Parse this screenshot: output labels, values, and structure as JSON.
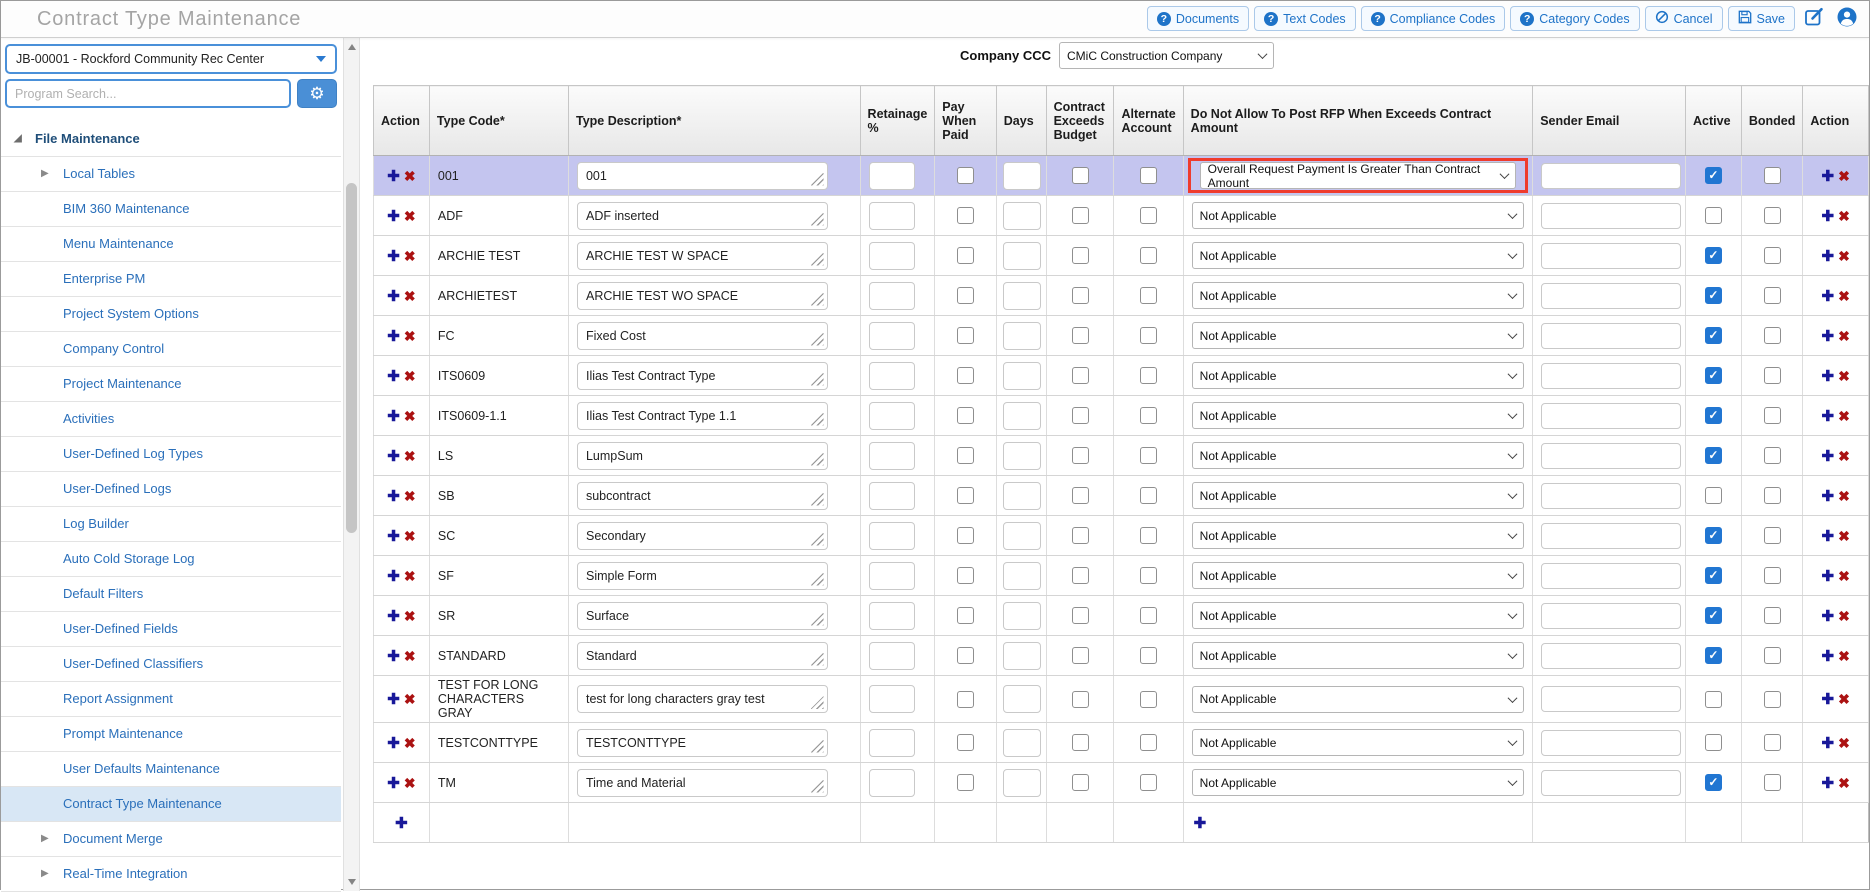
{
  "header": {
    "title": "Contract Type Maintenance",
    "buttons": [
      {
        "label": "Documents",
        "icon": "help-icon"
      },
      {
        "label": "Text Codes",
        "icon": "help-icon"
      },
      {
        "label": "Compliance Codes",
        "icon": "help-icon"
      },
      {
        "label": "Category Codes",
        "icon": "help-icon"
      },
      {
        "label": "Cancel",
        "icon": "cancel-icon"
      },
      {
        "label": "Save",
        "icon": "save-icon"
      }
    ],
    "icon_buttons": [
      {
        "name": "edit-icon"
      },
      {
        "name": "user-icon"
      }
    ]
  },
  "sidebar": {
    "project_select": "JB-00001 - Rockford Community Rec Center",
    "search_placeholder": "Program Search...",
    "tree": [
      {
        "label": "File Maintenance",
        "level": 0,
        "state": "expanded"
      },
      {
        "label": "Local Tables",
        "level": 1,
        "state": "collapsed"
      },
      {
        "label": "BIM 360 Maintenance",
        "level": 1
      },
      {
        "label": "Menu Maintenance",
        "level": 1
      },
      {
        "label": "Enterprise PM",
        "level": 1
      },
      {
        "label": "Project System Options",
        "level": 1
      },
      {
        "label": "Company Control",
        "level": 1
      },
      {
        "label": "Project Maintenance",
        "level": 1
      },
      {
        "label": "Activities",
        "level": 1
      },
      {
        "label": "User-Defined Log Types",
        "level": 1
      },
      {
        "label": "User-Defined Logs",
        "level": 1
      },
      {
        "label": "Log Builder",
        "level": 1
      },
      {
        "label": "Auto Cold Storage Log",
        "level": 1
      },
      {
        "label": "Default Filters",
        "level": 1
      },
      {
        "label": "User-Defined Fields",
        "level": 1
      },
      {
        "label": "User-Defined Classifiers",
        "level": 1
      },
      {
        "label": "Report Assignment",
        "level": 1
      },
      {
        "label": "Prompt Maintenance",
        "level": 1
      },
      {
        "label": "User Defaults Maintenance",
        "level": 1
      },
      {
        "label": "Contract Type Maintenance",
        "level": 1,
        "selected": true
      },
      {
        "label": "Document Merge",
        "level": 1,
        "state": "collapsed"
      },
      {
        "label": "Real-Time Integration",
        "level": 1,
        "state": "collapsed"
      }
    ]
  },
  "main": {
    "company_label": "Company CCC",
    "company_value": "CMiC Construction Company",
    "table": {
      "columns": [
        "Action",
        "Type Code*",
        "Type Description*",
        "Retainage %",
        "Pay When Paid",
        "Days",
        "Contract Exceeds Budget",
        "Alternate Account",
        "Do Not Allow To Post RFP When Exceeds Contract Amount",
        "Sender Email",
        "Active",
        "Bonded",
        "Action"
      ],
      "rows": [
        {
          "code": "001",
          "desc": "001",
          "rfp": "Overall Request Payment Is Greater Than Contract Amount",
          "retainage": "",
          "pay_when_paid": false,
          "days": "",
          "contract_exceeds_budget": false,
          "alternate_account": false,
          "sender_email": "",
          "active": true,
          "bonded": false,
          "selected": true,
          "rfp_highlight": true
        },
        {
          "code": "ADF",
          "desc": "ADF inserted",
          "rfp": "Not Applicable",
          "active": false,
          "bonded": false
        },
        {
          "code": "ARCHIE TEST",
          "desc": "ARCHIE TEST W SPACE",
          "rfp": "Not Applicable",
          "active": true,
          "bonded": false
        },
        {
          "code": "ARCHIETEST",
          "desc": "ARCHIE TEST WO SPACE",
          "rfp": "Not Applicable",
          "active": true,
          "bonded": false
        },
        {
          "code": "FC",
          "desc": "Fixed Cost",
          "rfp": "Not Applicable",
          "active": true,
          "bonded": false
        },
        {
          "code": "ITS0609",
          "desc": "Ilias Test Contract Type",
          "rfp": "Not Applicable",
          "active": true,
          "bonded": false
        },
        {
          "code": "ITS0609-1.1",
          "desc": "Ilias Test Contract Type 1.1",
          "rfp": "Not Applicable",
          "active": true,
          "bonded": false
        },
        {
          "code": "LS",
          "desc": "LumpSum",
          "rfp": "Not Applicable",
          "active": true,
          "bonded": false
        },
        {
          "code": "SB",
          "desc": "subcontract",
          "rfp": "Not Applicable",
          "active": false,
          "bonded": false
        },
        {
          "code": "SC",
          "desc": "Secondary",
          "rfp": "Not Applicable",
          "active": true,
          "bonded": false
        },
        {
          "code": "SF",
          "desc": "Simple Form",
          "rfp": "Not Applicable",
          "active": true,
          "bonded": false
        },
        {
          "code": "SR",
          "desc": "Surface",
          "rfp": "Not Applicable",
          "active": true,
          "bonded": false
        },
        {
          "code": "STANDARD",
          "desc": "Standard",
          "rfp": "Not Applicable",
          "active": true,
          "bonded": false
        },
        {
          "code": "TEST FOR LONG CHARACTERS GRAY",
          "desc": "test for long characters gray test",
          "rfp": "Not Applicable",
          "active": false,
          "bonded": false
        },
        {
          "code": "TESTCONTTYPE",
          "desc": "TESTCONTTYPE",
          "rfp": "Not Applicable",
          "active": false,
          "bonded": false
        },
        {
          "code": "TM",
          "desc": "Time and Material",
          "rfp": "Not Applicable",
          "active": true,
          "bonded": false
        }
      ]
    }
  },
  "colors": {
    "accent_blue": "#1e73c8",
    "sidebar_border_blue": "#4a90d9",
    "row_selected": "#c4c5ef",
    "annotation_red": "#ef3b2d",
    "checkbox_checked": "#2176d2",
    "plus_icon": "#181899",
    "delete_icon": "#ab1212",
    "selected_tree_bg": "#d8e7f5"
  }
}
